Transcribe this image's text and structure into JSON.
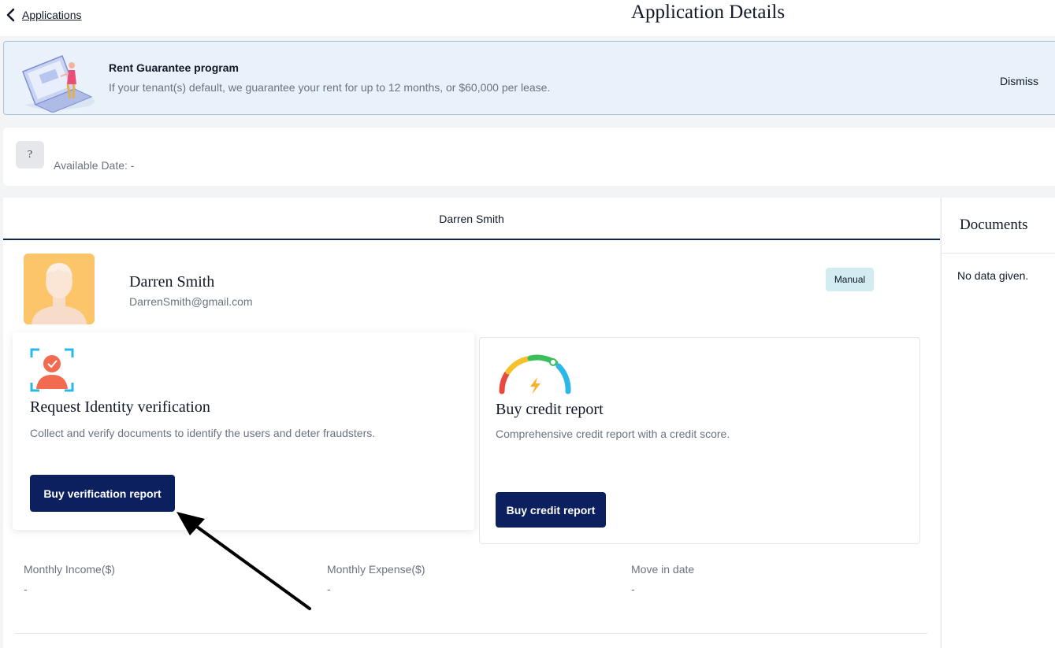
{
  "header": {
    "back_label": "Applications",
    "title": "Application Details"
  },
  "banner": {
    "title": "Rent Guarantee program",
    "text": "If your tenant(s) default, we guarantee your rent for up to 12 months, or $60,000 per lease.",
    "dismiss_label": "Dismiss"
  },
  "availability": {
    "badge": "?",
    "label": "Available Date: -"
  },
  "tabs": [
    {
      "label": "Darren Smith",
      "active": true
    }
  ],
  "applicant": {
    "name": "Darren Smith",
    "email": "DarrenSmith@gmail.com",
    "badge": "Manual"
  },
  "cards": {
    "identity": {
      "title": "Request Identity verification",
      "description": "Collect and verify documents to identify the users and deter fraudsters.",
      "button_label": "Buy verification report",
      "icon": "identity-verification-icon"
    },
    "credit": {
      "title": "Buy credit report",
      "description": "Comprehensive credit report with a credit score.",
      "button_label": "Buy credit report",
      "icon": "credit-gauge-icon"
    }
  },
  "stats": [
    {
      "label": "Monthly Income($)",
      "value": "-"
    },
    {
      "label": "Monthly Expense($)",
      "value": "-"
    },
    {
      "label": "Move in date",
      "value": "-"
    }
  ],
  "documents": {
    "title": "Documents",
    "empty_text": "No data given."
  },
  "colors": {
    "primary_button": "#0c1f5e",
    "banner_bg": "#e9f2fa",
    "badge_bg": "#d2ecf1",
    "avatar_bg": "#fdc56a"
  }
}
